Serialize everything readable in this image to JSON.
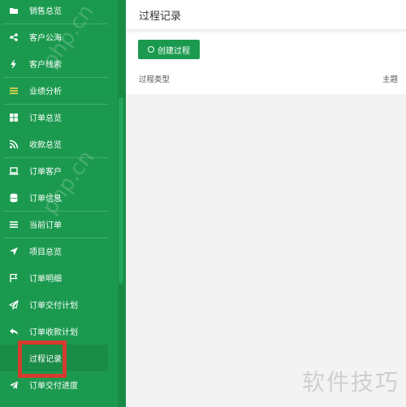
{
  "sidebar": {
    "items": [
      {
        "label": "销售总览",
        "icon": "folder-open-icon"
      },
      {
        "label": "客户公海",
        "icon": "share-icon"
      },
      {
        "label": "客户线索",
        "icon": "bolt-icon"
      },
      {
        "label": "业绩分析",
        "icon": "list-icon"
      },
      {
        "label": "订单总览",
        "icon": "grid-icon"
      },
      {
        "label": "收款总览",
        "icon": "rss-icon"
      },
      {
        "label": "订单客户",
        "icon": "laptop-icon"
      },
      {
        "label": "订单信息",
        "icon": "database-icon"
      },
      {
        "label": "当前订单",
        "icon": "list-icon"
      },
      {
        "label": "项目总览",
        "icon": "location-arrow-icon"
      },
      {
        "label": "订单明细",
        "icon": "flag-icon"
      },
      {
        "label": "订单交付计划",
        "icon": "paper-plane-icon"
      },
      {
        "label": "订单收款计划",
        "icon": "reply-icon"
      },
      {
        "label": "过程记录",
        "icon": ""
      },
      {
        "label": "订单交付进度",
        "icon": "send-icon"
      }
    ]
  },
  "header": {
    "title": "过程记录"
  },
  "toolbar": {
    "create_label": "创建过程"
  },
  "table": {
    "columns": [
      "过程类型",
      "主题"
    ]
  },
  "watermark": {
    "text": "软件技巧",
    "php": "php.cn"
  },
  "colors": {
    "sidebar": "#1b9a4f",
    "highlight_border": "#d63b2f"
  }
}
